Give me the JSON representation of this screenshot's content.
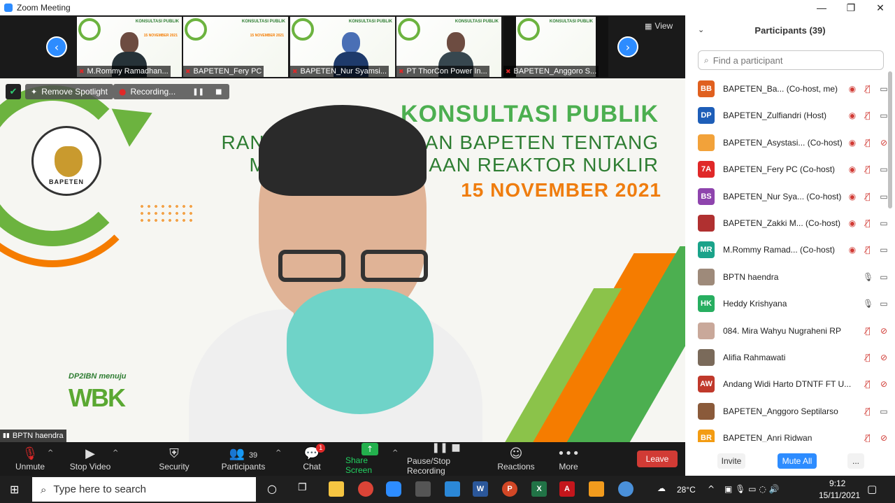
{
  "window": {
    "title": "Zoom Meeting"
  },
  "strip": {
    "view_label": "View",
    "thumbnails": [
      {
        "name": "M.Rommy Ramadhan..."
      },
      {
        "name": "BAPETEN_Fery PC"
      },
      {
        "name": "BAPETEN_Nur Syamsi..."
      },
      {
        "name": "PT ThorCon Power In..."
      },
      {
        "name": "BAPETEN_Anggoro S..."
      }
    ]
  },
  "stage": {
    "slide_title": "KONSULTASI PUBLIK",
    "slide_sub1": "RANCANG              RAN BAPETEN TENTANG",
    "slide_sub2": "MAN                      AAN REAKTOR NUKLIR",
    "slide_date": "15 NOVEMBER 2021",
    "emblem_text": "BAPETEN",
    "wbk_top": "DP2IBN menuju",
    "wbk": "WBK",
    "remove_spotlight": "Remove Spotlight",
    "recording": "Recording...",
    "speaker_name": "BPTN haendra"
  },
  "toolbar": {
    "unmute": "Unmute",
    "stop_video": "Stop Video",
    "security": "Security",
    "participants": "Participants",
    "participants_count": "39",
    "chat": "Chat",
    "chat_badge": "1",
    "share_screen": "Share Screen",
    "pause_recording": "Pause/Stop Recording",
    "reactions": "Reactions",
    "more": "More",
    "leave": "Leave"
  },
  "panel": {
    "title": "Participants (39)",
    "search_placeholder": "Find a participant",
    "invite": "Invite",
    "mute_all": "Mute All",
    "more": "...",
    "participants": [
      {
        "initials": "BB",
        "color": "#e0601f",
        "name": "BAPETEN_Ba...   (Co-host, me)",
        "rec": true,
        "mic": "muted",
        "cam": "on"
      },
      {
        "initials": "DP",
        "color": "#1e5eb8",
        "name": "BAPETEN_Zulfiandri (Host)",
        "rec": true,
        "mic": "muted",
        "cam": "on"
      },
      {
        "initials": "",
        "color": "#f2a23a",
        "name": "BAPETEN_Asystasi... (Co-host)",
        "rec": true,
        "mic": "muted",
        "cam": "off"
      },
      {
        "initials": "7A",
        "color": "#e02828",
        "name": "BAPETEN_Fery PC (Co-host)",
        "rec": true,
        "mic": "muted",
        "cam": "on"
      },
      {
        "initials": "BS",
        "color": "#8e44ad",
        "name": "BAPETEN_Nur Sya... (Co-host)",
        "rec": true,
        "mic": "muted",
        "cam": "on"
      },
      {
        "initials": "",
        "color": "#b03030",
        "name": "BAPETEN_Zakki M... (Co-host)",
        "rec": true,
        "mic": "muted",
        "cam": "on"
      },
      {
        "initials": "MR",
        "color": "#1aa38a",
        "name": "M.Rommy Ramad... (Co-host)",
        "rec": true,
        "mic": "muted",
        "cam": "on"
      },
      {
        "initials": "",
        "color": "#9e8a7a",
        "name": "BPTN haendra",
        "rec": false,
        "mic": "on",
        "cam": "on"
      },
      {
        "initials": "HK",
        "color": "#27ae60",
        "name": "Heddy Krishyana",
        "rec": false,
        "mic": "on",
        "cam": "on"
      },
      {
        "initials": "",
        "color": "#c9a89a",
        "name": "084. Mira Wahyu Nugraheni RP",
        "rec": false,
        "mic": "muted",
        "cam": "off"
      },
      {
        "initials": "",
        "color": "#7a6a5a",
        "name": "Alifia Rahmawati",
        "rec": false,
        "mic": "muted",
        "cam": "off"
      },
      {
        "initials": "AW",
        "color": "#c0392b",
        "name": "Andang Widi Harto DTNTF FT U...",
        "rec": false,
        "mic": "muted",
        "cam": "off"
      },
      {
        "initials": "",
        "color": "#8a5a3a",
        "name": "BAPETEN_Anggoro Septilarso",
        "rec": false,
        "mic": "muted",
        "cam": "on"
      },
      {
        "initials": "BR",
        "color": "#f39c12",
        "name": "BAPETEN_Anri Ridwan",
        "rec": false,
        "mic": "muted",
        "cam": "off"
      }
    ]
  },
  "taskbar": {
    "search_placeholder": "Type here to search",
    "weather": "28°C",
    "time": "9:12",
    "date": "15/11/2021"
  }
}
